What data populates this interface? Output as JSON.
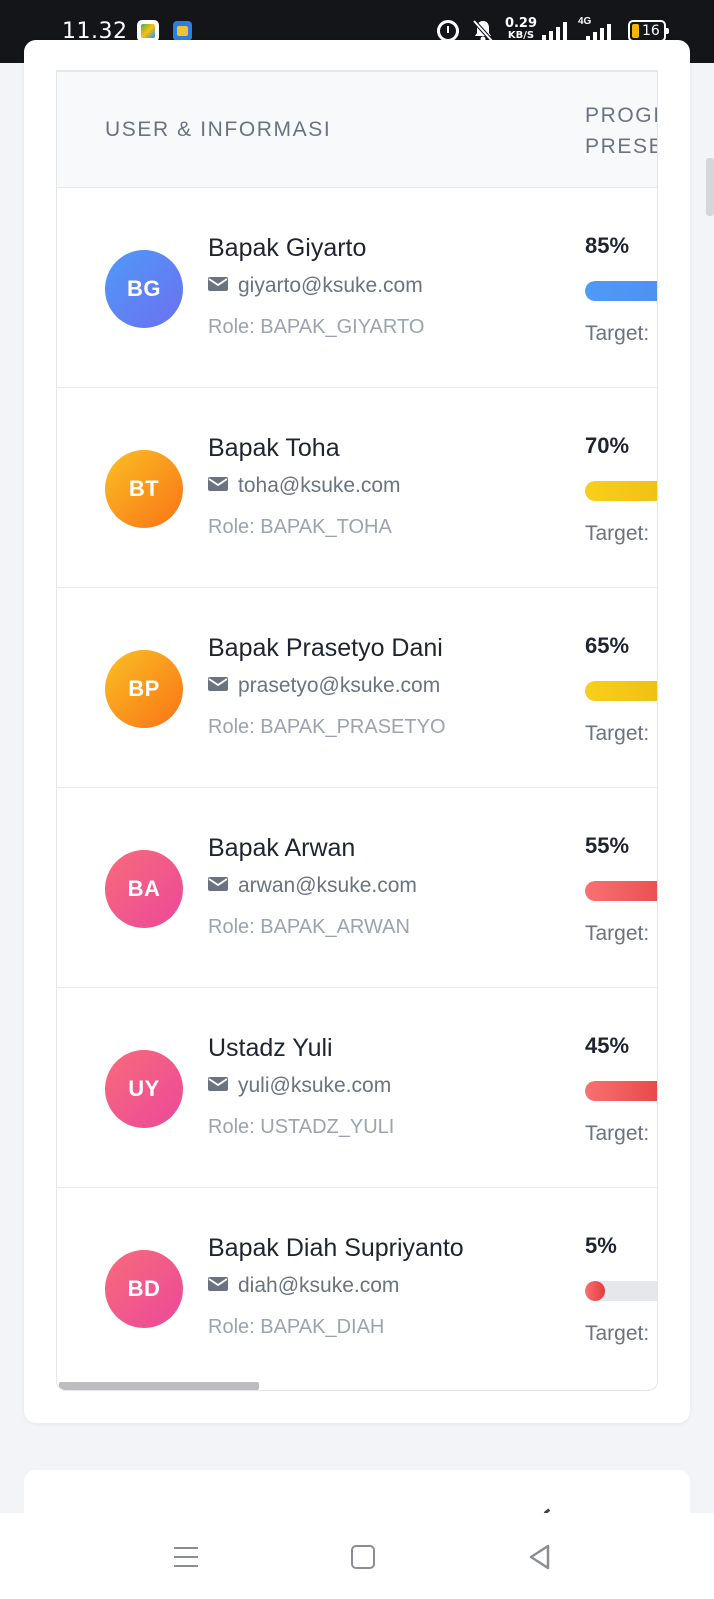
{
  "status_bar": {
    "time": "11.32",
    "net_speed_value": "0.29",
    "net_speed_unit": "KB/S",
    "network_type": "4G",
    "battery": "16",
    "battery_color": "#f4b400"
  },
  "table": {
    "header_user": "USER & INFORMASI",
    "header_progress_line1": "PROGI",
    "header_progress_line2": "PRESE"
  },
  "rows": [
    {
      "initials": "BG",
      "name": "Bapak Giyarto",
      "email": "giyarto@ksuke.com",
      "role": "Role: BAPAK_GIYARTO",
      "percent_label": "85%",
      "progress": 0.85,
      "target_label": "Target:",
      "avatar_from": "#4f9af7",
      "avatar_to": "#6c6ff0",
      "bar_from": "#4f9af7",
      "bar_to": "#4b84ea"
    },
    {
      "initials": "BT",
      "name": "Bapak Toha",
      "email": "toha@ksuke.com",
      "role": "Role: BAPAK_TOHA",
      "percent_label": "70%",
      "progress": 0.7,
      "target_label": "Target:",
      "avatar_from": "#fbbf24",
      "avatar_to": "#f97316",
      "bar_from": "#f8cf1a",
      "bar_to": "#e7b20f"
    },
    {
      "initials": "BP",
      "name": "Bapak Prasetyo Dani",
      "email": "prasetyo@ksuke.com",
      "role": "Role: BAPAK_PRASETYO",
      "percent_label": "65%",
      "progress": 0.65,
      "target_label": "Target:",
      "avatar_from": "#fbbf24",
      "avatar_to": "#f97316",
      "bar_from": "#f8cf1a",
      "bar_to": "#e7b20f"
    },
    {
      "initials": "BA",
      "name": "Bapak Arwan",
      "email": "arwan@ksuke.com",
      "role": "Role: BAPAK_ARWAN",
      "percent_label": "55%",
      "progress": 0.55,
      "target_label": "Target:",
      "avatar_from": "#f76b7b",
      "avatar_to": "#ec4899",
      "bar_from": "#f87171",
      "bar_to": "#e33b3b"
    },
    {
      "initials": "UY",
      "name": "Ustadz Yuli",
      "email": "yuli@ksuke.com",
      "role": "Role: USTADZ_YULI",
      "percent_label": "45%",
      "progress": 0.45,
      "target_label": "Target:",
      "avatar_from": "#f76b7b",
      "avatar_to": "#ec4899",
      "bar_from": "#f87171",
      "bar_to": "#e33b3b"
    },
    {
      "initials": "BD",
      "name": "Bapak Diah Supriyanto",
      "email": "diah@ksuke.com",
      "role": "Role: BAPAK_DIAH",
      "percent_label": "5%",
      "progress": 0.05,
      "target_label": "Target:",
      "avatar_from": "#f76b7b",
      "avatar_to": "#ec4899",
      "bar_from": "#f87171",
      "bar_to": "#e33b3b"
    }
  ],
  "icons": {
    "email": "mail-icon",
    "nav_menu": "menu-icon",
    "nav_home": "home-icon",
    "nav_back": "back-icon"
  }
}
